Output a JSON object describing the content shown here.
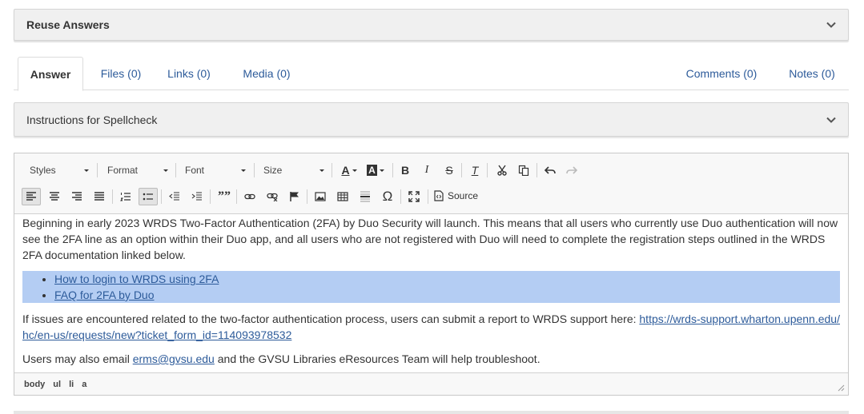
{
  "panels": {
    "reuse_title": "Reuse Answers",
    "spellcheck_title": "Instructions for Spellcheck"
  },
  "tabs": {
    "answer": "Answer",
    "files": "Files (0)",
    "links": "Links (0)",
    "media": "Media (0)",
    "comments": "Comments (0)",
    "notes": "Notes (0)"
  },
  "toolbar": {
    "styles": "Styles",
    "format": "Format",
    "font": "Font",
    "size": "Size",
    "source": "Source",
    "glyph_bold": "B",
    "glyph_italic": "I",
    "glyph_strike": "S",
    "glyph_clear": "T",
    "glyph_quote": "””",
    "glyph_omega": "Ω",
    "glyph_text_color": "A",
    "glyph_bg_color": "A"
  },
  "content": {
    "para1": "Beginning in early 2023 WRDS Two-Factor Authentication (2FA) by Duo Security will launch. This means that all users who currently use Duo authentication will now see the 2FA line as an option within their Duo app, and all users who are not registered with Duo will need to complete the registration steps outlined in the WRDS 2FA documentation linked below.",
    "list": [
      "How to login to WRDS using 2FA",
      "FAQ for 2FA by Duo"
    ],
    "para2_text": "If issues are encountered related to the two-factor authentication process, users can submit a report to WRDS support here: ",
    "para2_link": "https://wrds-support.wharton.upenn.edu/hc/en-us/requests/new?ticket_form_id=114093978532",
    "para3_before": "Users may also email ",
    "para3_link": "erms@gvsu.edu",
    "para3_after": " and the GVSU Libraries eResources Team will help troubleshoot."
  },
  "statusbar": {
    "path": [
      "body",
      "ul",
      "li",
      "a"
    ]
  },
  "colors": {
    "link": "#2d5b9a",
    "selection": "#b4cdf3",
    "panel_bg": "#f0f0f0"
  }
}
